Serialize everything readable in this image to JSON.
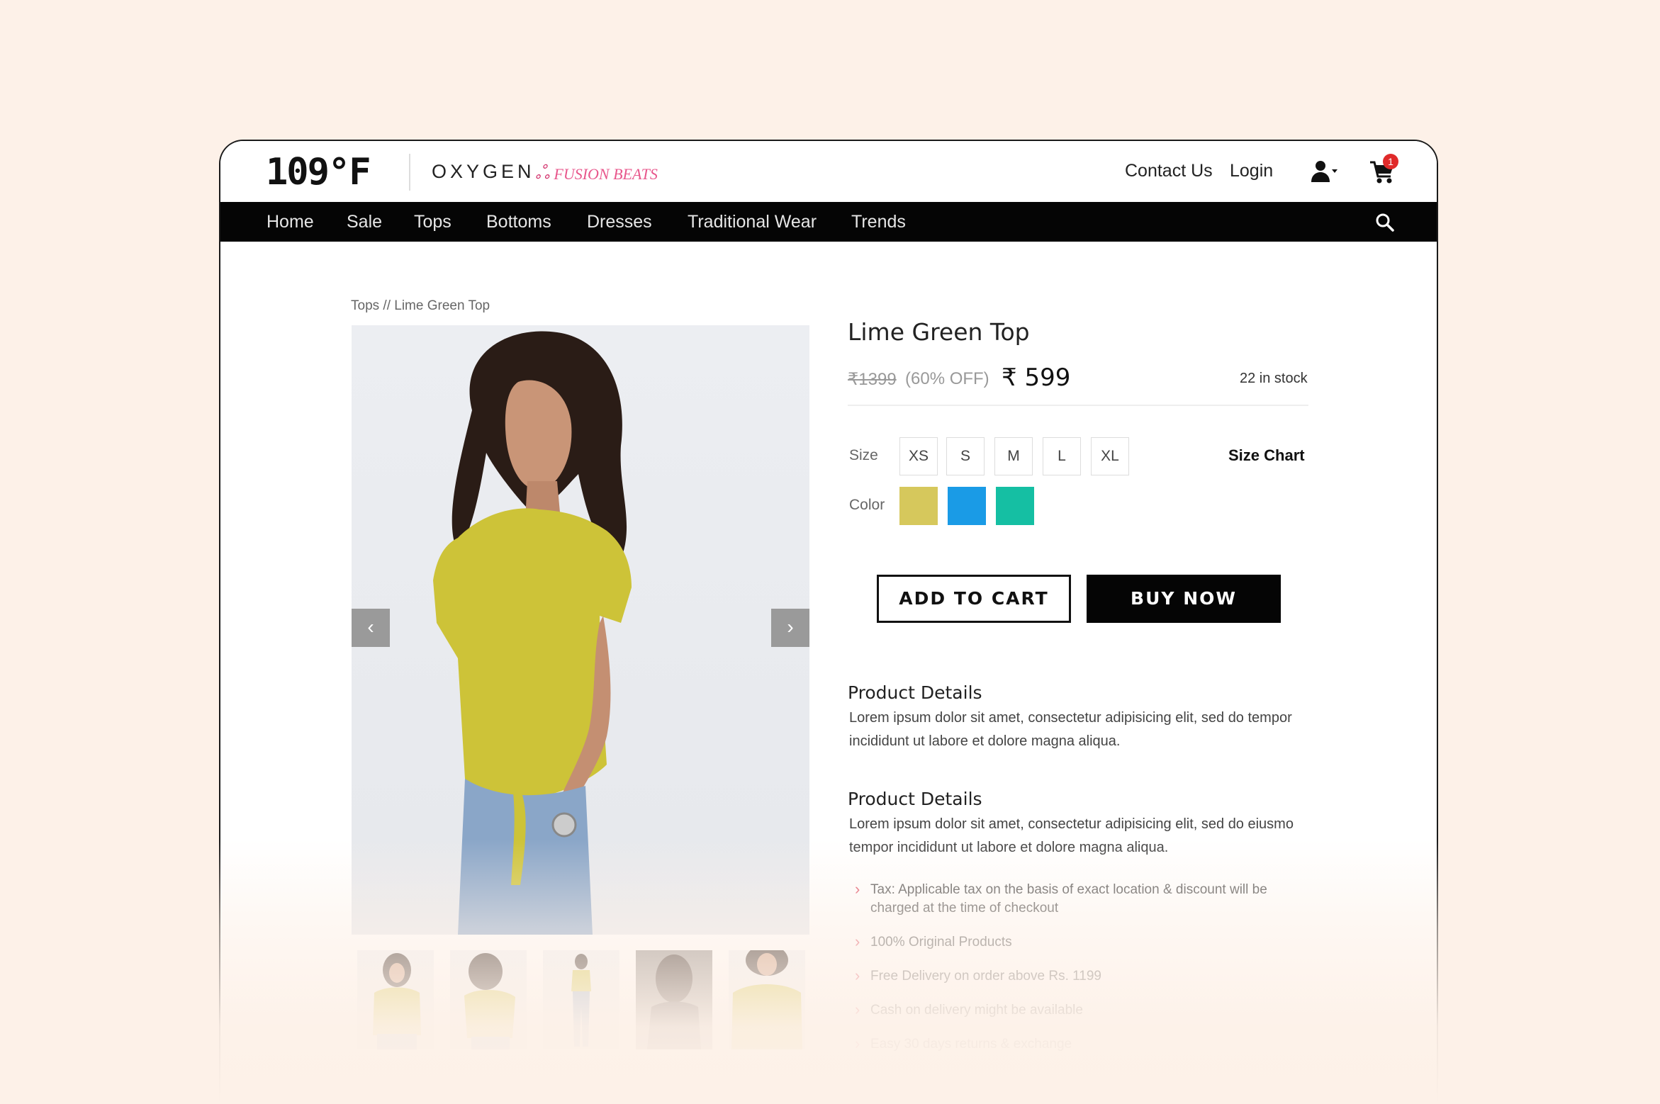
{
  "brand": {
    "logo_main": "109°F",
    "logo_secondary": "OXYGEN",
    "logo_tertiary": "FUSION BEATS"
  },
  "header": {
    "contact_label": "Contact Us",
    "login_label": "Login",
    "cart_count": "1"
  },
  "nav": {
    "items": [
      "Home",
      "Sale",
      "Tops",
      "Bottoms",
      "Dresses",
      "Traditional Wear",
      "Trends"
    ]
  },
  "breadcrumb": "Tops // Lime Green Top",
  "product": {
    "title": "Lime Green Top",
    "old_price": "₹1399",
    "discount": "(60% OFF)",
    "price": "₹ 599",
    "stock": "22 in stock",
    "size_label": "Size",
    "sizes": [
      "XS",
      "S",
      "M",
      "L",
      "XL"
    ],
    "size_chart_label": "Size Chart",
    "color_label": "Color",
    "colors": [
      "#d6c85c",
      "#1a9be6",
      "#15bfa3"
    ],
    "add_to_cart_label": "ADD TO CART",
    "buy_now_label": "BUY NOW",
    "arrow_prev": "‹",
    "arrow_next": "›"
  },
  "details": [
    {
      "heading": "Product Details",
      "text": "Lorem ipsum dolor sit amet, consectetur adipisicing elit, sed do  tempor incididunt ut labore et dolore magna aliqua."
    },
    {
      "heading": "Product Details",
      "text": "Lorem ipsum dolor sit amet, consectetur adipisicing elit, sed do eiusmo tempor incididunt ut labore et dolore magna aliqua."
    }
  ],
  "bullets": [
    "Tax: Applicable tax on the basis of exact location & discount will be charged at the time of checkout",
    "100% Original Products",
    "Free Delivery on order above Rs. 1199",
    "Cash on delivery might be available",
    "Easy 30 days returns & exchange"
  ],
  "theme": {
    "accent": "#050505",
    "background": "#fdf1e8",
    "badge": "#e02a2a",
    "top_color": "#cdc338"
  }
}
